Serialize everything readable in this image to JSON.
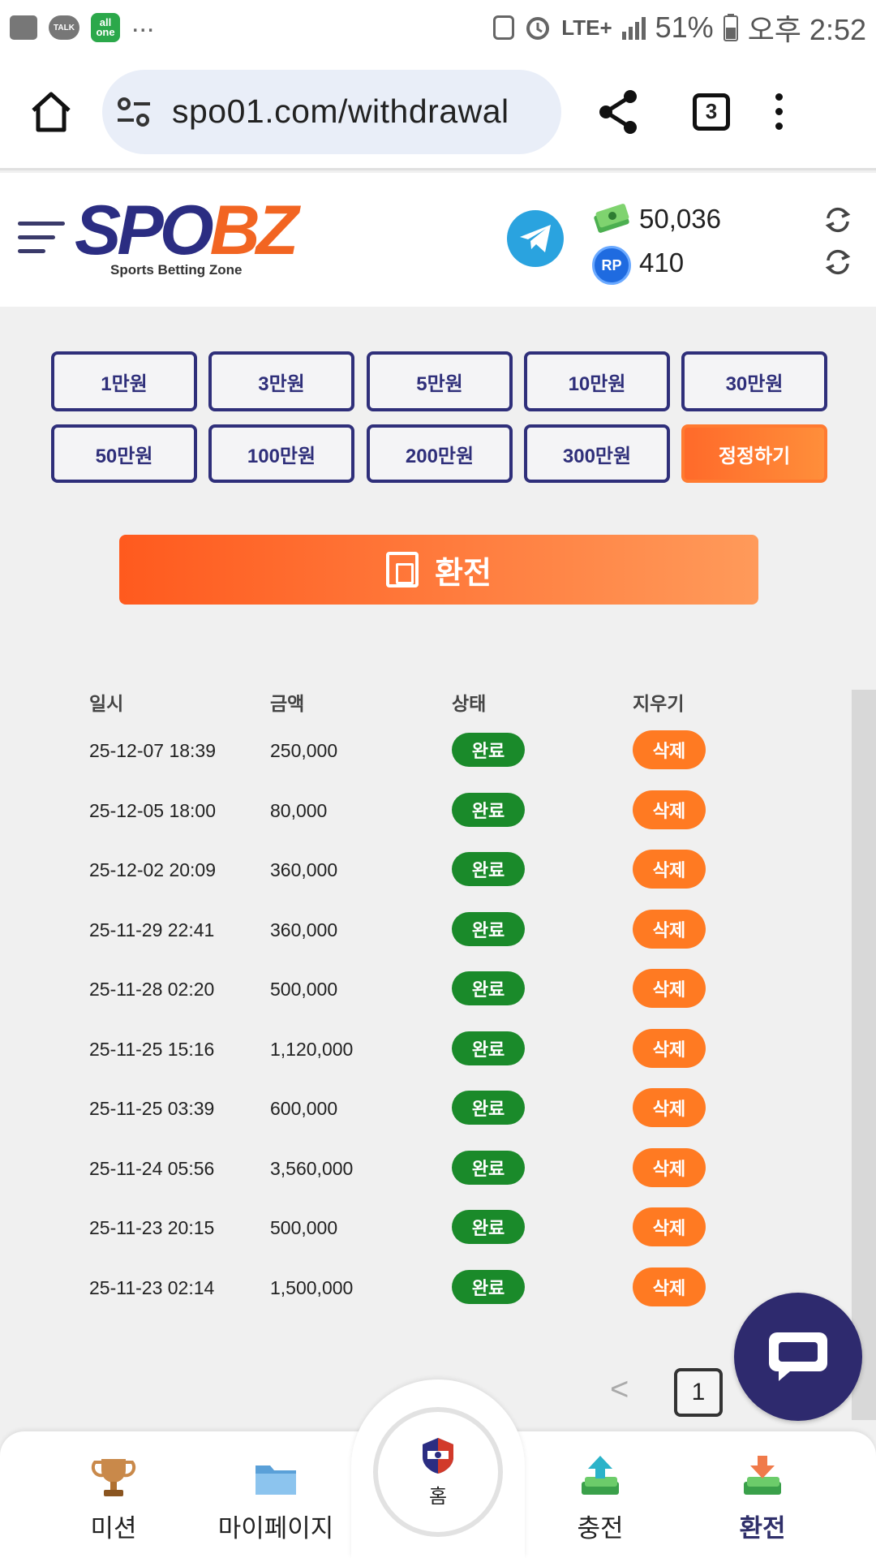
{
  "status_bar": {
    "talk_label": "TALK",
    "allone_label": "all one",
    "more": "...",
    "network": "LTE+",
    "battery": "51%",
    "time": "오후 2:52"
  },
  "browser": {
    "url": "spo01.com/withdrawal",
    "tab_count": "3"
  },
  "header": {
    "logo_spo": "SPO",
    "logo_bz": "BZ",
    "logo_tagline": "Sports Betting Zone",
    "money_balance": "50,036",
    "rp_label": "RP",
    "rp_balance": "410"
  },
  "amount_buttons": [
    "1만원",
    "3만원",
    "5만원",
    "10만원",
    "30만원",
    "50만원",
    "100만원",
    "200만원",
    "300만원"
  ],
  "correct_button": "정정하기",
  "withdraw_button": "환전",
  "table": {
    "headers": [
      "일시",
      "금액",
      "상태",
      "지우기"
    ],
    "rows": [
      {
        "date": "25-12-07 18:39",
        "amount": "250,000",
        "status": "완료",
        "action": "삭제"
      },
      {
        "date": "25-12-05 18:00",
        "amount": "80,000",
        "status": "완료",
        "action": "삭제"
      },
      {
        "date": "25-12-02 20:09",
        "amount": "360,000",
        "status": "완료",
        "action": "삭제"
      },
      {
        "date": "25-11-29 22:41",
        "amount": "360,000",
        "status": "완료",
        "action": "삭제"
      },
      {
        "date": "25-11-28 02:20",
        "amount": "500,000",
        "status": "완료",
        "action": "삭제"
      },
      {
        "date": "25-11-25 15:16",
        "amount": "1,120,000",
        "status": "완료",
        "action": "삭제"
      },
      {
        "date": "25-11-25 03:39",
        "amount": "600,000",
        "status": "완료",
        "action": "삭제"
      },
      {
        "date": "25-11-24 05:56",
        "amount": "3,560,000",
        "status": "완료",
        "action": "삭제"
      },
      {
        "date": "25-11-23 20:15",
        "amount": "500,000",
        "status": "완료",
        "action": "삭제"
      },
      {
        "date": "25-11-23 02:14",
        "amount": "1,500,000",
        "status": "완료",
        "action": "삭제"
      }
    ]
  },
  "pagination": {
    "prev": "<",
    "current": "1"
  },
  "bottom_nav": {
    "mission": "미션",
    "mypage": "마이페이지",
    "home": "홈",
    "deposit": "충전",
    "withdraw": "환전"
  },
  "colors": {
    "brand_navy": "#2b2d82",
    "brand_orange": "#f26522",
    "status_green": "#1a8a2a",
    "delete_orange": "#ff7a22"
  }
}
